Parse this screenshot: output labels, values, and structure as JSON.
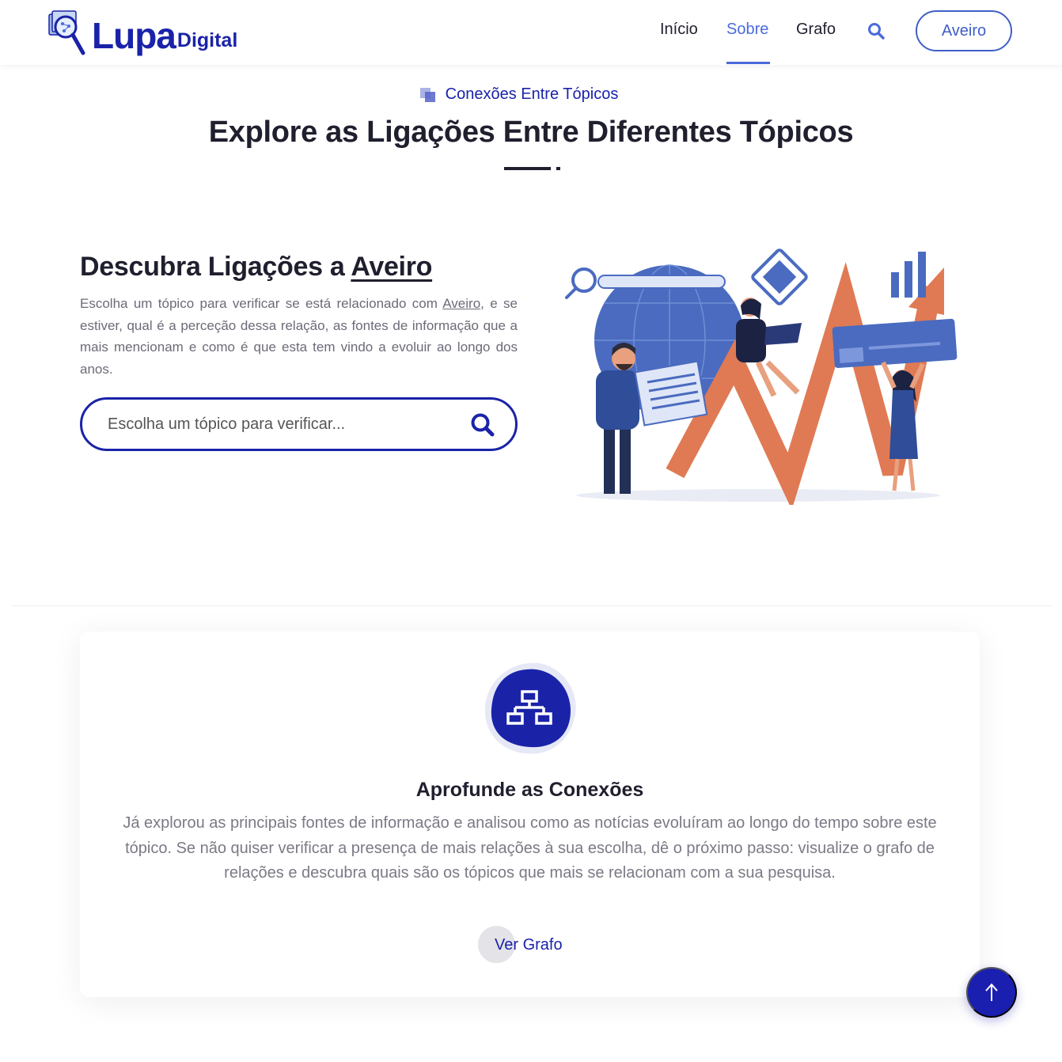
{
  "header": {
    "logo_main": "Lupa",
    "logo_sub": "Digital",
    "nav": [
      {
        "label": "Início",
        "active": false
      },
      {
        "label": "Sobre",
        "active": true
      },
      {
        "label": "Grafo",
        "active": false
      }
    ],
    "search_icon": "search-icon",
    "topic_button": "Aveiro"
  },
  "section": {
    "eyebrow": "Conexões Entre Tópicos",
    "title": "Explore as Ligações Entre Diferentes Tópicos"
  },
  "discover": {
    "title_prefix": "Descubra Ligações a ",
    "topic": "Aveiro",
    "text_prefix": "Escolha um tópico para verificar se está relacionado com ",
    "text_suffix": ", e se estiver, qual é a perceção dessa relação, as fontes de informação que a mais mencionam e como é que esta tem vindo a evoluir ao longo dos anos.",
    "search_placeholder": "Escolha um tópico para verificar...",
    "search_value": ""
  },
  "card": {
    "icon": "network-icon",
    "title": "Aprofunde as Conexões",
    "text": "Já explorou as principais fontes de informação e analisou como as notícias evoluíram ao longo do tempo sobre este tópico. Se não quiser verificar a presença de mais relações à sua escolha, dê o próximo passo: visualize o grafo de relações e descubra quais são os tópicos que mais se relacionam com a sua pesquisa.",
    "link_label": "Ver Grafo"
  },
  "back_to_top_icon": "arrow-up-icon",
  "colors": {
    "brand": "#1a23a8",
    "accent": "#4b6bdb",
    "illustration_orange": "#e07a54",
    "illustration_blue": "#4a6bbf"
  }
}
